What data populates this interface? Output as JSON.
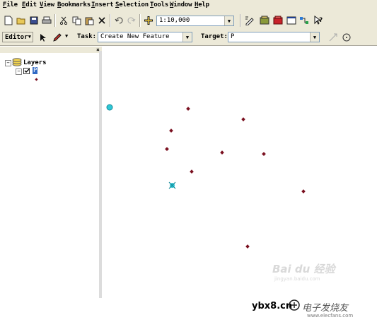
{
  "menu": [
    "File",
    "Edit",
    "View",
    "Bookmarks",
    "Insert",
    "Selection",
    "Tools",
    "Window",
    "Help"
  ],
  "toolbar": {
    "scale_value": "1:10,000",
    "icons": [
      "new-icon",
      "open-icon",
      "save-icon",
      "print-icon",
      "cut-icon",
      "copy-icon",
      "paste-icon",
      "delete-icon",
      "undo-icon",
      "redo-icon",
      "add-data-icon",
      "editor-toolbar-icon",
      "arctoolbox-icon",
      "arccatalog-icon",
      "command-line-icon",
      "model-builder-icon",
      "whats-this-icon"
    ]
  },
  "editor": {
    "editor_label": "Editor",
    "task_label": "Task:",
    "task_value": "Create New Feature",
    "target_label": "Target:",
    "target_value": "P"
  },
  "toc": {
    "root_label": "Layers",
    "layer_name": "P",
    "close_glyph": "×"
  },
  "map": {
    "point_count": 11,
    "point_color": "#7a1020",
    "vertex_color": "#2ec7d6"
  },
  "watermark": {
    "baidu": "Bai du 经验",
    "baidu_sub": "jingyan.baidu.com",
    "site1": "ybx8.cn",
    "site2": "电子发烧友",
    "site2_sub": "www.elecfans.com"
  }
}
